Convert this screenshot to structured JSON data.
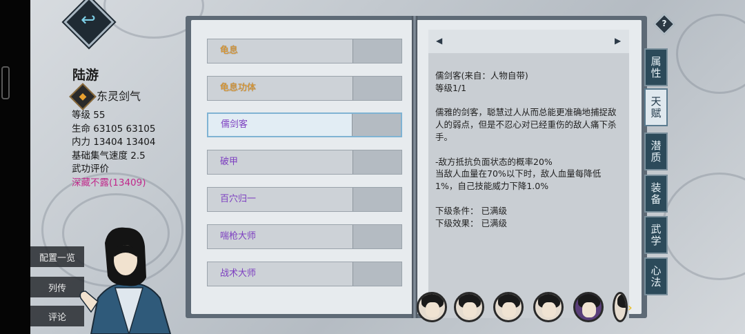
{
  "character": {
    "name": "陆游",
    "school": "东灵剑气",
    "stats": {
      "level": "等级 55",
      "hp": "生命 63105 63105",
      "mp": "内力 13404 13404",
      "qi_speed": "基础集气速度 2.5",
      "rating_label": "武功评价",
      "rating_value": "深藏不露(13409)"
    }
  },
  "left_menu": [
    "配置一览",
    "列传",
    "评论"
  ],
  "skills": [
    {
      "label": "龟息",
      "selected": false
    },
    {
      "label": "龟息功体",
      "selected": false
    },
    {
      "label": "儒剑客",
      "selected": true
    },
    {
      "label": "破甲",
      "selected": false
    },
    {
      "label": "百穴归一",
      "selected": false
    },
    {
      "label": "喘枪大师",
      "selected": false
    },
    {
      "label": "战术大师",
      "selected": false
    }
  ],
  "detail": {
    "title": "儒剑客(来自：人物自带)",
    "level": "等级1/1",
    "desc": "儒雅的剑客，聪慧过人从而总能更准确地捕捉敌人的弱点，但是不忍心对已经重伤的敌人痛下杀手。",
    "effect1": "-敌方抵抗负面状态的概率20%",
    "effect2": "当敌人血量在70%以下时，敌人血量每降低1%，自己技能威力下降1.0%",
    "next_cond": "下级条件：  已满级",
    "next_effect": "下级效果：  已满级"
  },
  "tabs": [
    "属性",
    "天赋",
    "潜质",
    "装备",
    "武学",
    "心法"
  ],
  "active_tab": "天赋",
  "help_label": "?",
  "colors": {
    "skill_text": "#e09a2e",
    "highlight": "#7fb3d3",
    "rating": "#c0288a"
  }
}
